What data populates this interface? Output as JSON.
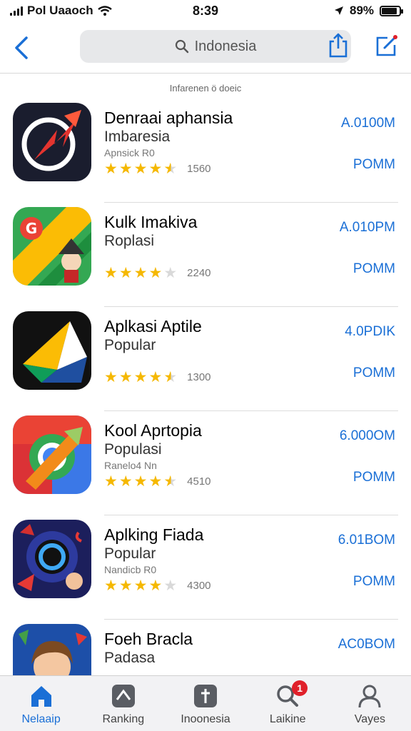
{
  "status_bar": {
    "carrier": "Pol Uaaoch",
    "time": "8:39",
    "battery": "89%",
    "battery_level": 0.89
  },
  "nav": {
    "search_text": "Indonesia"
  },
  "section_caption": "Infarenen ö doeic",
  "apps": [
    {
      "title": "Denraai aphansia",
      "subtitle": "Imbaresia",
      "meta": "Apnsick R0",
      "rating": 4.5,
      "count": "1560",
      "price_top": "A.0100M",
      "price_bottom": "POMM"
    },
    {
      "title": "Kulk Imakiva",
      "subtitle": "Roplasi",
      "meta": "",
      "rating": 4,
      "count": "2240",
      "price_top": "A.010PM",
      "price_bottom": "POMM"
    },
    {
      "title": "Aplkasi Aptile",
      "subtitle": "Popular",
      "meta": "",
      "rating": 4.5,
      "count": "1300",
      "price_top": "4.0PDIK",
      "price_bottom": "POMM"
    },
    {
      "title": "Kool Aprtopia",
      "subtitle": "Populasi",
      "meta": "Ranelo4 Nn",
      "rating": 4.5,
      "count": "4510",
      "price_top": "6.000OM",
      "price_bottom": "POMM"
    },
    {
      "title": "Aplking Fiada",
      "subtitle": "Popular",
      "meta": "Nandicb R0",
      "rating": 4,
      "count": "4300",
      "price_top": "6.01BOM",
      "price_bottom": "POMM"
    },
    {
      "title": "Foeh Bracla",
      "subtitle": "Padasa",
      "meta": "",
      "rating": 0,
      "count": "",
      "price_top": "AC0BOM",
      "price_bottom": ""
    }
  ],
  "tabs": [
    {
      "label": "Nelaaip",
      "icon": "home-icon",
      "active": true
    },
    {
      "label": "Ranking",
      "icon": "ranking-icon",
      "active": false
    },
    {
      "label": "Inoonesia",
      "icon": "indonesia-icon",
      "active": false
    },
    {
      "label": "Laikine",
      "icon": "search-icon",
      "active": false,
      "badge": "1"
    },
    {
      "label": "Vayes",
      "icon": "profile-icon",
      "active": false
    }
  ],
  "colors": {
    "accent": "#1a6fd6",
    "star": "#f5b800",
    "badge": "#e0202a"
  }
}
